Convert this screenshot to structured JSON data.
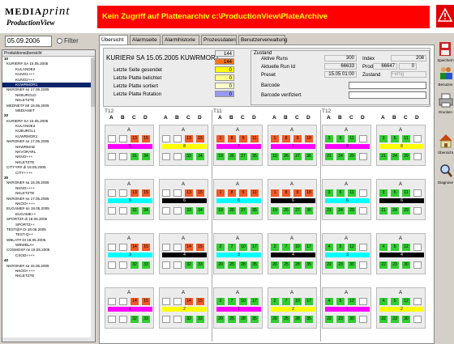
{
  "header": {
    "logo_top": "MEDIA",
    "logo_top_italic": "print",
    "logo_sub": "ProductionView",
    "banner": "Kein Zugriff auf Plattenarchiv c:\\ProductionView\\PlateArchive"
  },
  "left": {
    "date": "05.09.2006",
    "filter_label": "Filter",
    "tree_header": "Produktionsübersicht",
    "tree": [
      {
        "t": "10",
        "c": "sec"
      },
      {
        "t": "KURIER#  SA 15.05.2005",
        "c": "l1"
      },
      {
        "t": "KULANDE2",
        "c": "l2"
      },
      {
        "t": "KUNO1+++",
        "c": "l2"
      },
      {
        "t": "KUNO2+++",
        "c": "l2"
      },
      {
        "t": "KUWRMOR1",
        "c": "l2 sel"
      },
      {
        "t": "NKRONE#  so 17.05.2005",
        "c": "l1"
      },
      {
        "t": "NKBURGLD",
        "c": "l2"
      },
      {
        "t": "NKLETZTE",
        "c": "l2"
      },
      {
        "t": "MEDNET#  MI 19.05.2005",
        "c": "l1"
      },
      {
        "t": "MEDIANET",
        "c": "l2"
      },
      {
        "t": "20",
        "c": "sec"
      },
      {
        "t": "KURIER#  SA 15.05.2005",
        "c": "l1"
      },
      {
        "t": "KULANDE2",
        "c": "l2"
      },
      {
        "t": "KUBURGL1",
        "c": "l2"
      },
      {
        "t": "KUWRMOR1",
        "c": "l2"
      },
      {
        "t": "NKRONE#  so 17.05.2005",
        "c": "l1"
      },
      {
        "t": "NKWRMAB",
        "c": "l2"
      },
      {
        "t": "NKVORARL",
        "c": "l2"
      },
      {
        "t": "NKNO+++",
        "c": "l2"
      },
      {
        "t": "NKLETZTE",
        "c": "l2"
      },
      {
        "t": "CITYYR#  di 18.05.2005",
        "c": "l1"
      },
      {
        "t": "CITY++++",
        "c": "l2"
      },
      {
        "t": "30",
        "c": "sec"
      },
      {
        "t": "NKRONE#  sa 15.05.2005",
        "c": "l1"
      },
      {
        "t": "NKNO++++",
        "c": "l2"
      },
      {
        "t": "NKLETZTE",
        "c": "l2"
      },
      {
        "t": "NKRONE#  so 17.05.2005",
        "c": "l1"
      },
      {
        "t": "NKOO++++",
        "c": "l2"
      },
      {
        "t": "EUGAME#  so 18.05.2005",
        "c": "l1"
      },
      {
        "t": "EUGAME++",
        "c": "l2"
      },
      {
        "t": "SPORTZ#  di 18.05.2005",
        "c": "l1"
      },
      {
        "t": "SPORTZ++",
        "c": "l2"
      },
      {
        "t": "TEST@#  Di 18.05.2005",
        "c": "l1"
      },
      {
        "t": "TEST-Q++",
        "c": "l2"
      },
      {
        "t": "WBLAT#  DI 18.05.2005",
        "c": "l1"
      },
      {
        "t": "WBWBLA+",
        "c": "l2"
      },
      {
        "t": "COSMOS#  mi 19.05.2005",
        "c": "l1"
      },
      {
        "t": "CSOD++++",
        "c": "l2"
      },
      {
        "t": "40",
        "c": "sec"
      },
      {
        "t": "NKRONE#  sa 15.05.2005",
        "c": "l1"
      },
      {
        "t": "NKOO++++",
        "c": "l2"
      },
      {
        "t": "NKLETZTE",
        "c": "l2"
      }
    ]
  },
  "tabs": [
    "Übersicht",
    "Alarmseite",
    "Alarmhistorie",
    "Prozessdaten",
    "Benutzerverwaltung"
  ],
  "info": {
    "title": "KURIER#  SA 15.05.2005 KUWRMOR1",
    "rows": [
      {
        "label": "",
        "value": "144",
        "color": "#ececec"
      },
      {
        "label": "",
        "value": "144",
        "color": "#f07020"
      },
      {
        "label": "Letzte Seite gesendet",
        "value": "0",
        "color": "#ffff00"
      },
      {
        "label": "Letzte Platte belichtet",
        "value": "0",
        "color": "#ffff88"
      },
      {
        "label": "Letzte Platte sortiert",
        "value": "0",
        "color": "#ffffcc"
      },
      {
        "label": "Letzte Platte Rotation",
        "value": "0",
        "color": "#9999ee"
      }
    ],
    "zustand_title": "Zustand",
    "aktive_runs_label": "Aktive Runs",
    "aktive_runs": "300",
    "index_label": "Index",
    "index": "208",
    "run_id_label": "Aktuelle Run Id",
    "run_id": "66633",
    "prod_label": "Prod.",
    "prod": "66647",
    "prod2": "0",
    "preset_label": "Preset",
    "preset": "15.05 01:00",
    "zustand_label": "Zustand",
    "zustand_value": "Fertig",
    "barcode_label": "Barcode",
    "barcode_verif_label": "Barcode verifiziert"
  },
  "grid": {
    "sections": [
      "T12",
      "T11",
      "T12"
    ],
    "cols": [
      "A",
      "B",
      "C",
      "D"
    ],
    "rows": [
      [
        {
          "nums": [
            "",
            "",
            "13",
            "15"
          ],
          "tone": "o",
          "bar": "#ff00ff",
          "barlabel": "5",
          "bot": [
            "",
            "",
            "31",
            "34"
          ]
        },
        {
          "nums": [
            "",
            "",
            "13",
            "15"
          ],
          "tone": "o",
          "bar": "#ffff00",
          "barlabel": "8",
          "bot": [
            "",
            "",
            "33",
            "34"
          ]
        },
        {
          "nums": [
            "1",
            "8",
            "9",
            "11"
          ],
          "tone": "o",
          "bar": "#ff00ff",
          "barlabel": "7",
          "bot": [
            "19",
            "26",
            "27",
            "35"
          ]
        },
        {
          "nums": [
            "1",
            "8",
            "9",
            "18"
          ],
          "tone": "o",
          "bar": "#ff00ff",
          "barlabel": "7",
          "bot": [
            "19",
            "26",
            "27",
            "36"
          ]
        },
        {
          "nums": [
            "3",
            "6",
            "11",
            ""
          ],
          "tone": "g",
          "bar": "#ff00ff",
          "barlabel": "8",
          "bot": [
            "21",
            "24",
            "29",
            ""
          ]
        },
        {
          "nums": [
            "3",
            "6",
            "11",
            ""
          ],
          "tone": "g",
          "bar": "#ffff00",
          "barlabel": "8",
          "bot": [
            "21",
            "24",
            "29",
            ""
          ]
        }
      ],
      [
        {
          "nums": [
            "",
            "",
            "13",
            "15"
          ],
          "tone": "o",
          "bar": "#00ffff",
          "barlabel": "5",
          "bot": [
            "",
            "",
            "31",
            "34"
          ]
        },
        {
          "nums": [
            "",
            "",
            "13",
            "15"
          ],
          "tone": "o",
          "bar": "#000000",
          "barlabel": "6",
          "bot": [
            "",
            "",
            "33",
            "34"
          ]
        },
        {
          "nums": [
            "1",
            "8",
            "9",
            "11"
          ],
          "tone": "o",
          "bar": "#00ffff",
          "barlabel": "6",
          "bot": [
            "19",
            "26",
            "27",
            "35"
          ]
        },
        {
          "nums": [
            "1",
            "8",
            "9",
            "18"
          ],
          "tone": "o",
          "bar": "#000000",
          "barlabel": "6",
          "bot": [
            "19",
            "26",
            "27",
            "36"
          ]
        },
        {
          "nums": [
            "3",
            "6",
            "11",
            ""
          ],
          "tone": "g",
          "bar": "#00ffff",
          "barlabel": "6",
          "bot": [
            "21",
            "24",
            "29",
            ""
          ]
        },
        {
          "nums": [
            "3",
            "6",
            "11",
            ""
          ],
          "tone": "g",
          "bar": "#000000",
          "barlabel": "6",
          "bot": [
            "21",
            "24",
            "29",
            ""
          ]
        }
      ],
      [
        {
          "nums": [
            "",
            "",
            "14",
            "15"
          ],
          "tone": "o",
          "bar": "#00ffff",
          "barlabel": "3",
          "bot": [
            "",
            "",
            "32",
            "33"
          ]
        },
        {
          "nums": [
            "",
            "",
            "14",
            "15"
          ],
          "tone": "o",
          "bar": "#000000",
          "barlabel": "4",
          "bot": [
            "",
            "",
            "32",
            "33"
          ]
        },
        {
          "nums": [
            "2",
            "7",
            "10",
            "17"
          ],
          "tone": "g",
          "bar": "#00ffff",
          "barlabel": "3",
          "bot": [
            "20",
            "25",
            "28",
            "35"
          ]
        },
        {
          "nums": [
            "2",
            "7",
            "10",
            "17"
          ],
          "tone": "g",
          "bar": "#000000",
          "barlabel": "4",
          "bot": [
            "20",
            "25",
            "28",
            "35"
          ]
        },
        {
          "nums": [
            "4",
            "5",
            "12",
            ""
          ],
          "tone": "g",
          "bar": "#00ffff",
          "barlabel": "3",
          "bot": [
            "22",
            "23",
            "30",
            ""
          ]
        },
        {
          "nums": [
            "4",
            "5",
            "12",
            ""
          ],
          "tone": "g",
          "bar": "#000000",
          "barlabel": "4",
          "bot": [
            "22",
            "23",
            "30",
            ""
          ]
        }
      ],
      [
        {
          "nums": [
            "",
            "",
            "14",
            "15"
          ],
          "tone": "o",
          "bar": "#ff00ff",
          "barlabel": "1",
          "bot": [
            "",
            "",
            "32",
            "33"
          ]
        },
        {
          "nums": [
            "",
            "",
            "14",
            "15"
          ],
          "tone": "o",
          "bar": "#ffff00",
          "barlabel": "2",
          "bot": [
            "",
            "",
            "32",
            "33"
          ]
        },
        {
          "nums": [
            "2",
            "7",
            "10",
            "17"
          ],
          "tone": "g",
          "bar": "#ff00ff",
          "barlabel": "1",
          "bot": [
            "20",
            "25",
            "28",
            "35"
          ]
        },
        {
          "nums": [
            "2",
            "7",
            "10",
            "17"
          ],
          "tone": "g",
          "bar": "#ffff00",
          "barlabel": "2",
          "bot": [
            "20",
            "25",
            "28",
            "35"
          ]
        },
        {
          "nums": [
            "4",
            "5",
            "12",
            ""
          ],
          "tone": "g",
          "bar": "#ff00ff",
          "barlabel": "1",
          "bot": [
            "22",
            "23",
            "30",
            ""
          ]
        },
        {
          "nums": [
            "4",
            "5",
            "12",
            ""
          ],
          "tone": "g",
          "bar": "#ffff00",
          "barlabel": "2",
          "bot": [
            "22",
            "23",
            "30",
            ""
          ]
        }
      ]
    ]
  },
  "right_buttons": [
    {
      "label": "Speichern",
      "icon": "save-icon"
    },
    {
      "label": "Benutzer",
      "icon": "users-icon"
    },
    {
      "label": "Drucken",
      "icon": "print-icon"
    },
    {
      "label": "Übersicht",
      "icon": "home-icon"
    },
    {
      "label": "Diagnose",
      "icon": "magnifier-icon"
    }
  ]
}
